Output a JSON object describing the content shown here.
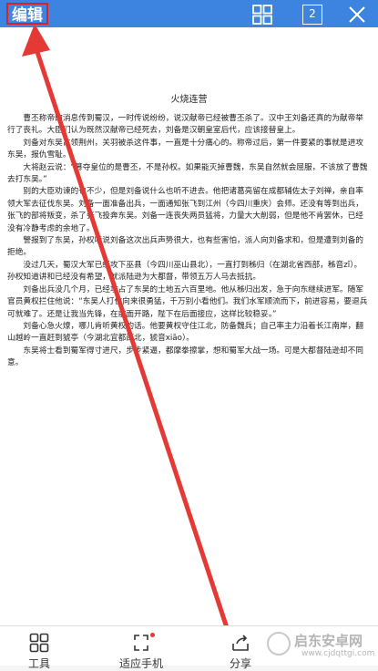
{
  "toolbar": {
    "edit_label": "编辑",
    "window_count": "2",
    "icons": [
      "grid-icon",
      "tab-count-icon",
      "close-icon"
    ]
  },
  "document": {
    "title": "火烧连营",
    "paragraphs": [
      "曹丕称帝的消息传到蜀汉，一时传说纷纷，说汉献帝已经被曹丕杀了。汉中王刘备还真的为献帝举行了丧礼。大臣们认为既然汉献帝已经死去，刘备是汉朝皇室后代，应该接替皇上。",
      "刘备对东吴占领荆州，关羽被杀这件事，一直是十分痛心的。称帝过后，第一件要紧的事就是进攻东吴，报仇雪耻。",
      "大将赵云说：“篡夺皇位的是曹丕，不是孙权。如果能灭掉曹魏，东吴自然就会屈服，不该放了曹魏去打东吴。”",
      "别的大臣劝谏的也不少，但是刘备说什么也听不进去。他把诸葛亮留在成都辅佐太子刘禅，亲自率领大军去征伐东吴。刘备一面准备出兵，一面通知张飞到江州（今四川重庆）会师。还没有等到出兵，张飞的部将叛变，杀了张飞投奔东吴。刘备一连丧失两员猛将，力量大大削弱，但是他不肯罢休，已经没有冷静考虑的余地了。",
      "警报到了东吴，孙权听说刘备这次出兵声势很大，也有些害怕，派人向刘备求和，但是遭到刘备的拒绝。",
      "没过几天，蜀汉大军已经攻下巫县（今四川巫山县北），一直打到秭归（在湖北省西部，秭音zǐ）。孙权知道讲和已经没有希望，就派陆逊为大都督，带领五万人马去抵抗。",
      "刘备出兵没几个月，已经攻占了东吴的土地五六百里地。他从秭归出发，急于向东继续进军。随军官员黄权拦住他说：“东吴人打仗向来很勇猛，千万别小看他们。我们水军顺流而下，前进容易，要退兵可就难了。还是让我当先锋，在前面开路，陛下在后面接应，这样比较稳妥。”",
      "刘备心急火燎，哪儿肯听黄权的话。他要黄权守住江北，防备魏兵；自己率主力沿着长江南岸，翻山越岭一直赶到猇亭（今湖北宜都西北，猇音xiāo）。",
      "东吴将士看到蜀军得寸进尺，步步紧逼，都摩拳擦掌，想和蜀军大战一场。可是大都督陆逊却不同意。"
    ]
  },
  "bottom_bar": {
    "tools_label": "工具",
    "fit_phone_label": "适应手机",
    "share_label": "分享"
  },
  "watermark": {
    "name": "启东安卓网",
    "url": "www.cjdqttgi.com"
  },
  "colors": {
    "toolbar_bg": "#3d84e0",
    "highlight": "#e02020",
    "arrow": "#e53935"
  }
}
